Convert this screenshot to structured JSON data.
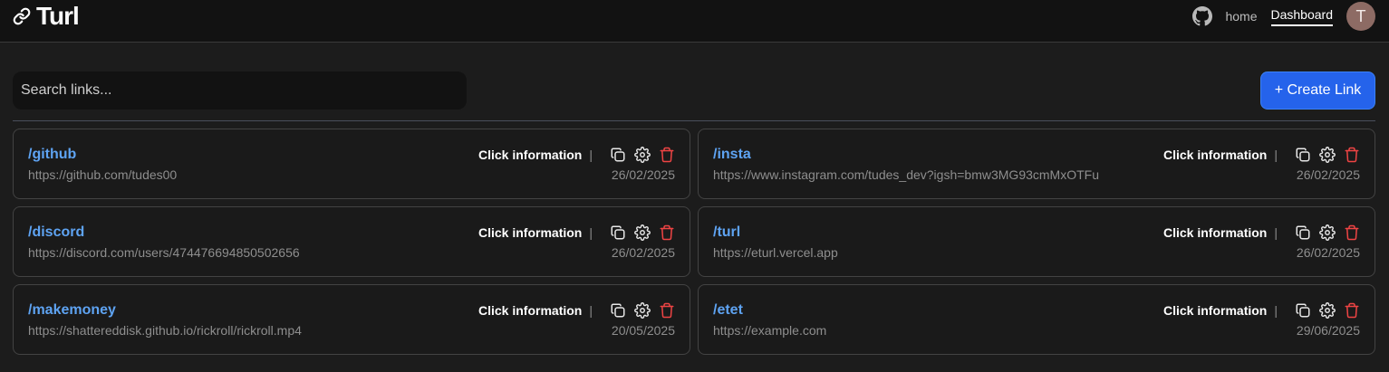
{
  "app": {
    "name": "Turl"
  },
  "nav": {
    "items": [
      {
        "label": "home",
        "active": false
      },
      {
        "label": "Dashboard",
        "active": true
      }
    ],
    "avatar_initial": "T"
  },
  "search": {
    "placeholder": "Search links...",
    "value": ""
  },
  "create_button": {
    "label": "+ Create Link"
  },
  "card_labels": {
    "click_information": "Click information",
    "separator": "|"
  },
  "colors": {
    "accent": "#2563eb",
    "slug": "#5ea3f2",
    "delete": "#ef4444",
    "avatar": "#8d6b64"
  },
  "links": [
    {
      "slug": "/github",
      "url": "https://github.com/tudes00",
      "date": "26/02/2025"
    },
    {
      "slug": "/insta",
      "url": "https://www.instagram.com/tudes_dev?igsh=bmw3MG93cmMxOTFu",
      "date": "26/02/2025"
    },
    {
      "slug": "/discord",
      "url": "https://discord.com/users/474476694850502656",
      "date": "26/02/2025"
    },
    {
      "slug": "/turl",
      "url": "https://eturl.vercel.app",
      "date": "26/02/2025"
    },
    {
      "slug": "/makemoney",
      "url": "https://shattereddisk.github.io/rickroll/rickroll.mp4",
      "date": "20/05/2025"
    },
    {
      "slug": "/etet",
      "url": "https://example.com",
      "date": "29/06/2025"
    }
  ]
}
